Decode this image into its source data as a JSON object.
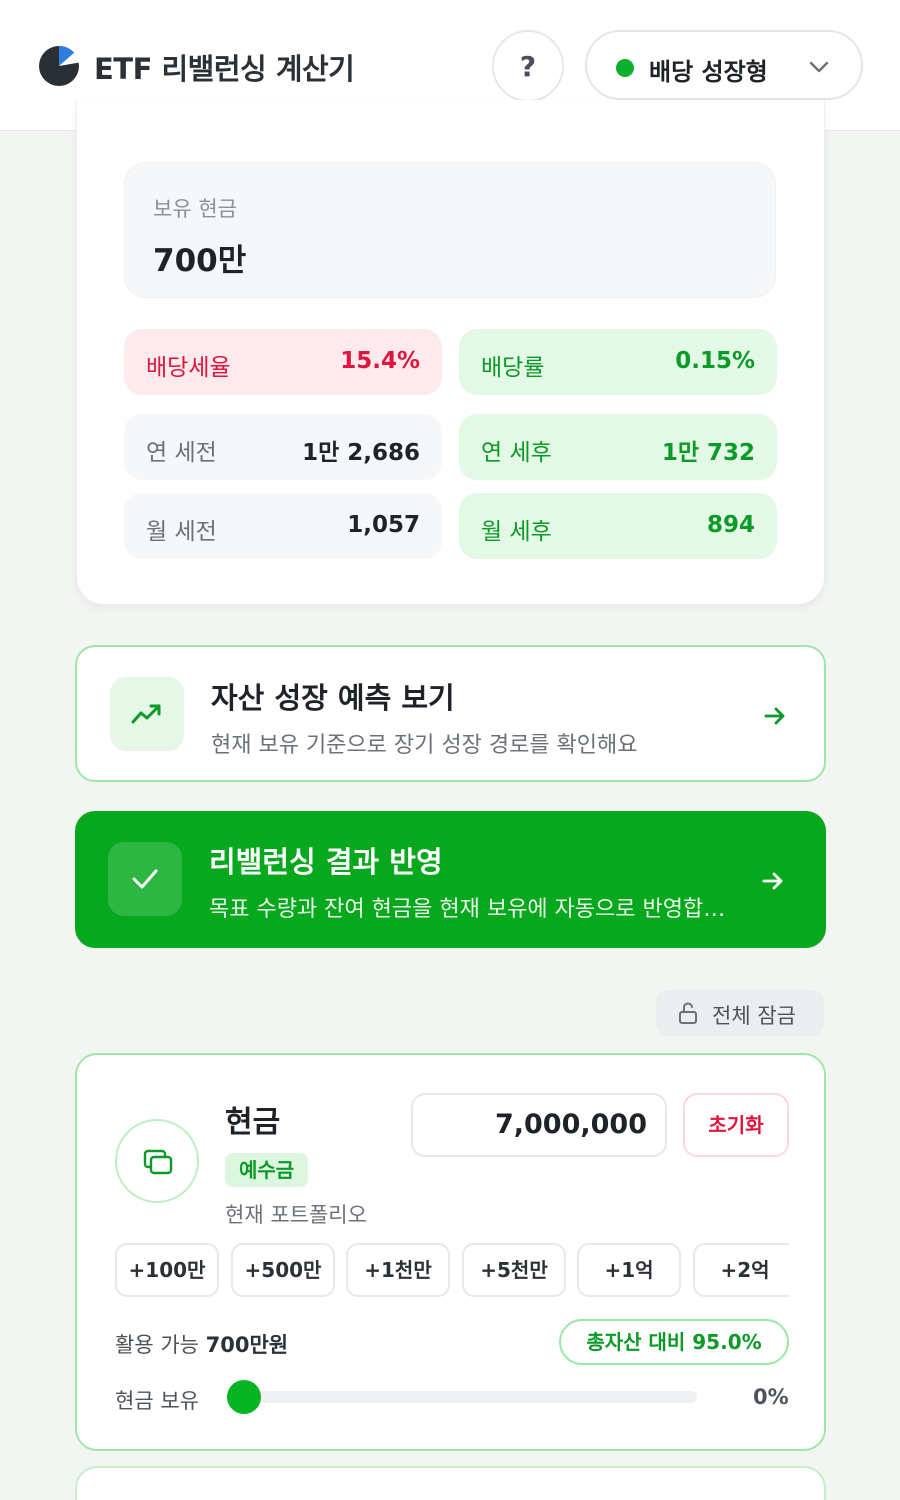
{
  "header": {
    "title": "ETF 리밸런싱 계산기",
    "help_label": "?",
    "preset_label": "배당 성장형",
    "colors": {
      "accent": "#07a81e",
      "danger": "#e0143c"
    }
  },
  "dividend": {
    "cash_label": "보유 현금",
    "cash_value": "700만",
    "tax_rate_label": "배당세율",
    "tax_rate_value": "15.4%",
    "yield_label": "배당률",
    "yield_value": "0.15%",
    "annual_pre_label": "연 세전",
    "annual_pre_value": "1만 2,686",
    "annual_post_label": "연 세후",
    "annual_post_value": "1만 732",
    "monthly_pre_label": "월 세전",
    "monthly_pre_value": "1,057",
    "monthly_post_label": "월 세후",
    "monthly_post_value": "894"
  },
  "growth_card": {
    "title": "자산 성장 예측 보기",
    "subtitle": "현재 보유 기준으로 장기 성장 경로를 확인해요"
  },
  "apply_card": {
    "title": "리밸런싱 결과 반영",
    "subtitle": "목표 수량과 잔여 현금을 현재 보유에 자동으로 반영합니다"
  },
  "lock_all_label": "전체 잠금",
  "cash_asset": {
    "name": "현금",
    "tag": "예수금",
    "description": "현재 포트폴리오",
    "amount": "7,000,000",
    "reset_label": "초기화",
    "chips": [
      "+100만",
      "+500만",
      "+1천만",
      "+5천만",
      "+1억",
      "+2억"
    ],
    "available_prefix": "활용 가능 ",
    "available_value": "700만원",
    "ratio_label": "총자산 대비 95.0%",
    "hold_label": "현금 보유",
    "hold_percent": "0%",
    "hold_fraction": 0
  }
}
